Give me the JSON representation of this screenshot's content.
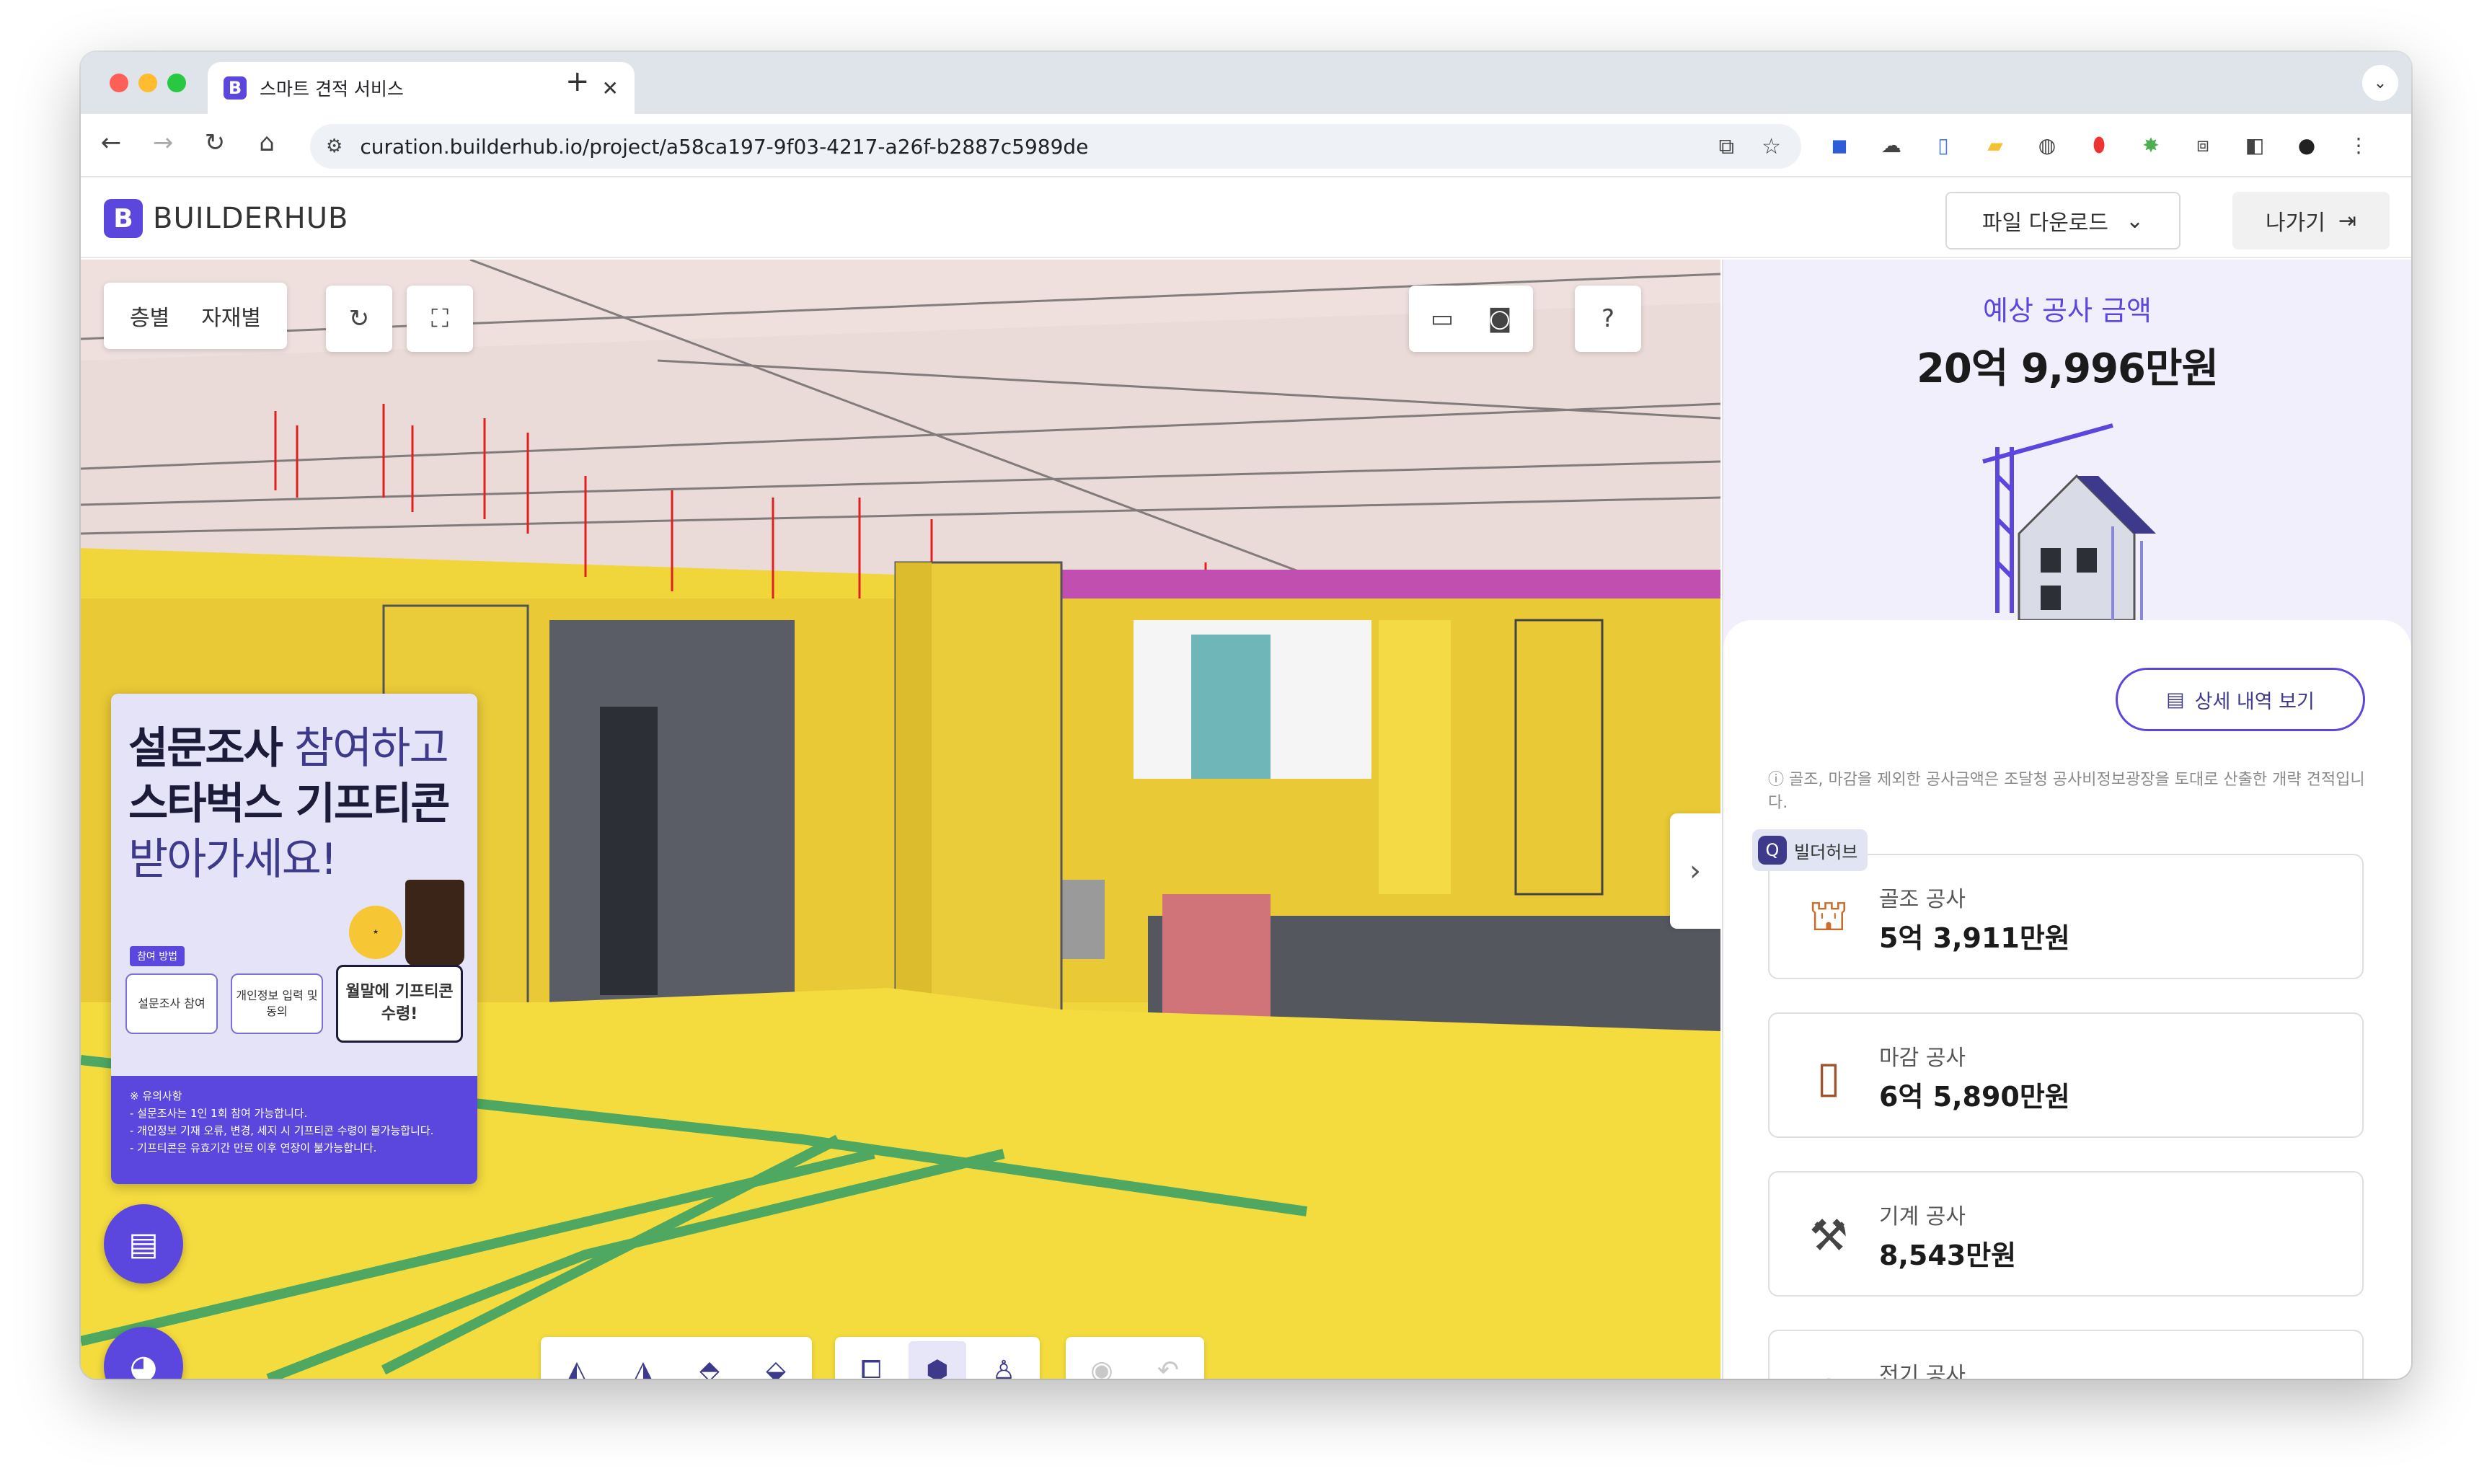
{
  "browser": {
    "tab_title": "스마트 견적 서비스",
    "url": "curation.builderhub.io/project/a58ca197-9f03-4217-a26f-b2887c5989de"
  },
  "app": {
    "logo_text": "BUILDERHUB",
    "download_label": "파일 다운로드",
    "exit_label": "나가기"
  },
  "viewer": {
    "tabs": [
      "층별",
      "자재별"
    ],
    "banner": {
      "line1_a": "설문조사",
      "line1_b": " 참여하고",
      "line2": "스타벅스 기프티콘",
      "line3": "받아가세요!",
      "step_chip": "참여 방법",
      "steps": [
        "설문조사 참여",
        "개인정보 입력 및 동의",
        "월말에 기프티콘 수령!"
      ],
      "notes_title": "※ 유의사항",
      "notes": [
        "- 설문조사는 1인 1회 참여 가능합니다.",
        "- 개인정보 기재 오류, 변경, 세지 시 기프티콘 수령이 불가능합니다.",
        "- 기프티콘은 유효기간 만료 이후 연장이 불가능합니다."
      ]
    }
  },
  "panel": {
    "estimate_label": "예상 공사 금액",
    "estimate_amount": "20억 9,996만원",
    "detail_button": "상세 내역 보기",
    "note": "골조, 마감을 제외한 공사금액은 조달청 공사비정보광장을 토대로 산출한 개략 견적입니다.",
    "tag": "빌더허브",
    "items": [
      {
        "label": "골조 공사",
        "value": "5억 3,911만원",
        "icon": "crane-icon"
      },
      {
        "label": "마감 공사",
        "value": "6억 5,890만원",
        "icon": "door-icon"
      },
      {
        "label": "기계 공사",
        "value": "8,543만원",
        "icon": "tools-icon"
      },
      {
        "label": "전기 공사",
        "value": "",
        "icon": "plug-icon"
      }
    ]
  },
  "colors": {
    "brand": "#5b47dd",
    "floor": "#f0d63a",
    "ceiling": "#efe0de"
  }
}
